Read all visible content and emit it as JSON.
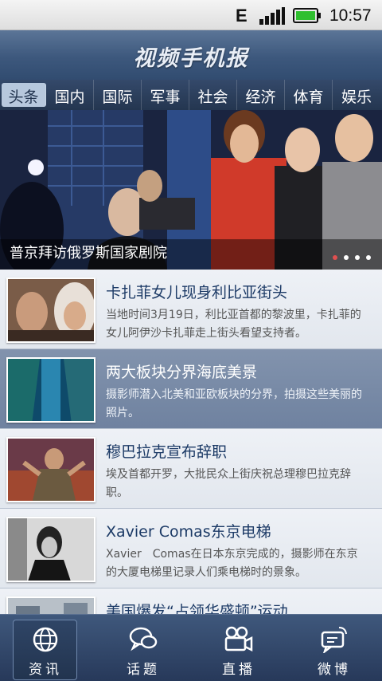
{
  "status_bar": {
    "network": "E",
    "time": "10:57"
  },
  "header": {
    "title": "视频手机报"
  },
  "tabs": [
    {
      "label": "头条"
    },
    {
      "label": "国内"
    },
    {
      "label": "国际"
    },
    {
      "label": "军事"
    },
    {
      "label": "社会"
    },
    {
      "label": "经济"
    },
    {
      "label": "体育"
    },
    {
      "label": "娱乐"
    }
  ],
  "active_tab": "头条",
  "hero": {
    "caption": "普京拜访俄罗斯国家剧院",
    "pages": 4,
    "current_page": 1
  },
  "news": [
    {
      "title": "卡扎菲女儿现身利比亚街头",
      "desc": "当地时间3月19日，利比亚首都的黎波里，卡扎菲的女儿阿伊沙卡扎菲走上街头看望支持者。"
    },
    {
      "title": "两大板块分界海底美景",
      "desc": "摄影师潜入北美和亚欧板块的分界，拍摄这些美丽的照片。"
    },
    {
      "title": "穆巴拉克宣布辞职",
      "desc": "埃及首都开罗，大批民众上街庆祝总理穆巴拉克辞职。"
    },
    {
      "title": "Xavier Comas东京电梯",
      "desc": "Xavier　Comas在日本东京完成的，摄影师在东京的大厦电梯里记录人们乘电梯时的景象。"
    },
    {
      "title": "美国爆发“占领华盛顿”运动",
      "desc": ""
    }
  ],
  "bottom_nav": [
    {
      "label": "资讯",
      "icon": "globe-icon"
    },
    {
      "label": "话题",
      "icon": "chat-bubbles-icon"
    },
    {
      "label": "直播",
      "icon": "video-camera-icon"
    },
    {
      "label": "微博",
      "icon": "microblog-icon"
    }
  ],
  "colors": {
    "accent": "#3d587d",
    "selected_row": "#7689a6",
    "title_text": "#1c3a66"
  }
}
